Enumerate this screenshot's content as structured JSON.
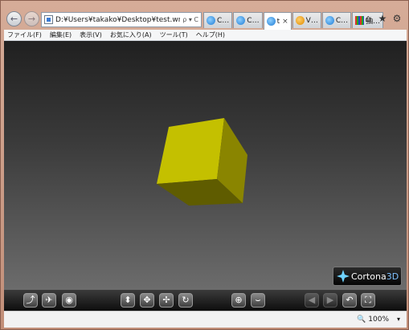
{
  "nav": {
    "back_icon": "back-arrow-icon",
    "forward_icon": "forward-arrow-icon",
    "address": "D:¥Users¥takako¥Desktop¥test.wrl",
    "address_tools": "ρ ▾ C"
  },
  "tabs": [
    {
      "label": "C…",
      "icon": "ie-icon",
      "active": false
    },
    {
      "label": "C…",
      "icon": "ie-icon",
      "active": false
    },
    {
      "label": "t",
      "icon": "ie-icon",
      "active": true,
      "close": "×"
    },
    {
      "label": "V…",
      "icon": "site-icon",
      "active": false
    },
    {
      "label": "C…",
      "icon": "ie-icon",
      "active": false
    },
    {
      "label": "抽…",
      "icon": "grid-icon",
      "active": false
    }
  ],
  "right_icons": {
    "home": "⌂",
    "favorites": "★",
    "settings": "⚙"
  },
  "menu": [
    {
      "label": "ファイル(F)"
    },
    {
      "label": "編集(E)"
    },
    {
      "label": "表示(V)"
    },
    {
      "label": "お気に入り(A)"
    },
    {
      "label": "ツール(T)"
    },
    {
      "label": "ヘルプ(H)"
    }
  ],
  "viewer": {
    "brand": "Cortona",
    "brand_suffix": "3D",
    "cube_colors": {
      "front": "#c4c000",
      "right": "#8a8500",
      "bottom": "#5f5c00"
    }
  },
  "toolbar": {
    "left": [
      {
        "name": "walk-icon",
        "glyph": "⤴"
      },
      {
        "name": "fly-icon",
        "glyph": "✈"
      },
      {
        "name": "study-eye-icon",
        "glyph": "◉"
      }
    ],
    "center": [
      {
        "name": "plan-icon",
        "glyph": "⬍"
      },
      {
        "name": "pan-icon",
        "glyph": "✥"
      },
      {
        "name": "turn-icon",
        "glyph": "✢"
      },
      {
        "name": "roll-icon",
        "glyph": "↻"
      }
    ],
    "middle": [
      {
        "name": "goto-icon",
        "glyph": "⊕"
      },
      {
        "name": "align-icon",
        "glyph": "⌣"
      }
    ],
    "right": [
      {
        "name": "prev-viewpoint-icon",
        "glyph": "◀",
        "dim": true
      },
      {
        "name": "next-viewpoint-icon",
        "glyph": "▶",
        "dim": true
      },
      {
        "name": "restore-icon",
        "glyph": "↶"
      },
      {
        "name": "fit-icon",
        "glyph": "⛶"
      }
    ]
  },
  "status": {
    "zoom": "100%",
    "zoom_icon": "🔍",
    "dropdown": "▾"
  }
}
